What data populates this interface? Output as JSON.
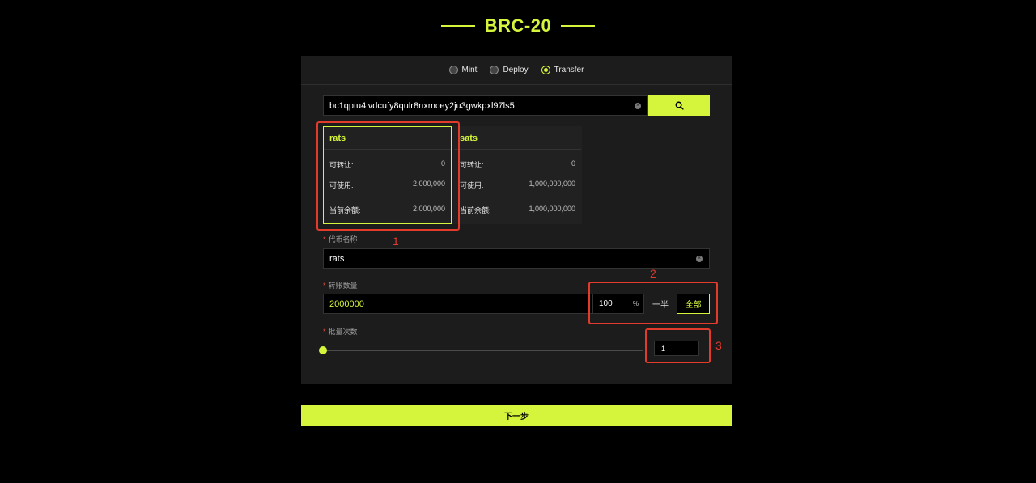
{
  "header": {
    "title": "BRC-20",
    "accent": "#d4f53c"
  },
  "tabs": [
    {
      "label": "Mint",
      "selected": false
    },
    {
      "label": "Deploy",
      "selected": false
    },
    {
      "label": "Transfer",
      "selected": true
    }
  ],
  "search": {
    "address": "bc1qptu4lvdcufy8qulr8nxmcey2ju3gwkpxl97ls5",
    "search_icon": "search-icon",
    "clear_icon": "close-circle-icon"
  },
  "tokens": [
    {
      "name": "rats",
      "selected": true,
      "transferable_label": "可转让:",
      "transferable": "0",
      "available_label": "可使用:",
      "available": "2,000,000",
      "balance_label": "当前余额:",
      "balance": "2,000,000"
    },
    {
      "name": "sats",
      "selected": false,
      "transferable_label": "可转让:",
      "transferable": "0",
      "available_label": "可使用:",
      "available": "1,000,000,000",
      "balance_label": "当前余额:",
      "balance": "1,000,000,000"
    }
  ],
  "form": {
    "token_name_label": "代币名称",
    "token_name_value": "rats",
    "amount_label": "转账数量",
    "amount_value": "2000000",
    "percent_value": "100",
    "percent_unit": "%",
    "half_label": "一半",
    "all_label": "全部",
    "batch_label": "批量次数",
    "batch_value": "1",
    "batch_slider_fraction": 0,
    "required_mark": "*"
  },
  "footer": {
    "next_label": "下一步"
  },
  "annotations": [
    {
      "label": "1"
    },
    {
      "label": "2"
    },
    {
      "label": "3"
    }
  ],
  "colors": {
    "annotation": "#e23a2b",
    "background": "#000000",
    "panel": "#1c1c1c"
  }
}
